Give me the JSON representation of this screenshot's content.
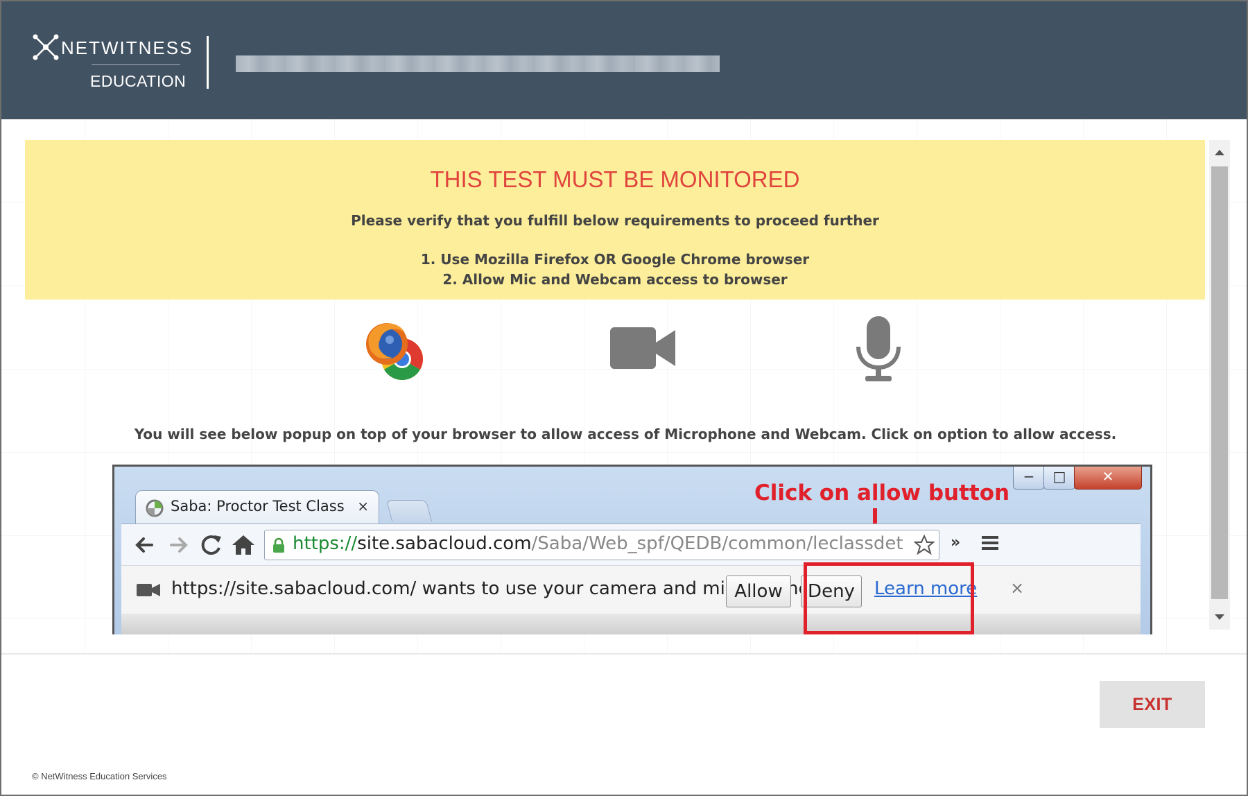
{
  "header": {
    "brand": "NETWITNESS",
    "brand_sub": "EDUCATION"
  },
  "banner": {
    "title": "THIS TEST MUST BE MONITORED",
    "subtitle": "Please verify that you fulfill below requirements to proceed further",
    "requirements": [
      "1. Use Mozilla Firefox OR Google Chrome browser",
      "2. Allow Mic and Webcam access to browser"
    ]
  },
  "icons": [
    "firefox-chrome-icon",
    "video-camera-icon",
    "microphone-icon"
  ],
  "info_text": "You will see below popup on top of your browser to allow access of Microphone and Webcam. Click on option to allow access.",
  "browser_shot": {
    "tab_title": "Saba: Proctor Test Class",
    "tab_close": "×",
    "annotation": "Click on allow button",
    "url_scheme": "https://",
    "url_host": "site.sabacloud.com",
    "url_path": "/Saba/Web_spf/QEDB/common/leclassdetail/regdw",
    "extensions": "»",
    "infobar_message": "https://site.sabacloud.com/ wants to use your camera and microphone.",
    "allow_label": "Allow",
    "deny_label": "Deny",
    "learn_more": "Learn more",
    "infobar_close": "×",
    "window_min": "−",
    "window_max": "□",
    "window_close": "✕"
  },
  "footer": {
    "exit_label": "EXIT",
    "copyright": "© NetWitness Education Services"
  },
  "colors": {
    "header_bg": "#415262",
    "banner_bg": "#fcee9a",
    "alert_red": "#e0443e",
    "annotation_red": "#e0202a"
  }
}
